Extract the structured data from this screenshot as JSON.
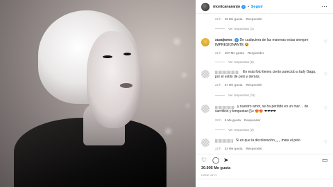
{
  "post": {
    "username": "monicanaranjo",
    "follow_label": "Seguir",
    "more_icon": "more-horizontal-icon",
    "verified_color": "#3897f0",
    "follow_color": "#0095f6"
  },
  "comments": [
    {
      "id": "c0",
      "meta": {
        "time": "22 h",
        "likes": "19 Me gusta",
        "reply": "Responder"
      },
      "replies": "Ver respuestas (1)"
    },
    {
      "id": "c1",
      "author": "xusojones",
      "text": "De cualquiera de las maneras estas siempre IMPRESIONANTE 😍",
      "meta": {
        "time": "21 h",
        "likes": "107 Me gusta",
        "reply": "Responder"
      },
      "replies": "Ver respuestas (6)"
    },
    {
      "id": "c2",
      "text": "En esta foto tienes cierto parecido a lady Gaga, por el estilo de pelo y demás.",
      "meta": {
        "time": "22 h",
        "likes": "37 Me gusta",
        "reply": "Responder"
      },
      "replies": "Ver respuestas (11)"
    },
    {
      "id": "c3",
      "text": "y nuestro amor, se ha perdido en un mar.... de sacrificio y tempestad 🌬 😍😍 ❤❤❤❤",
      "meta": {
        "time": "22 h",
        "likes": "6 Me gusta",
        "reply": "Responder"
      },
      "replies": "Ver respuestas (2)"
    },
    {
      "id": "c4",
      "text": "Si es que la decoloración,,,,,, mata el pelo",
      "meta": {
        "time": "22 h",
        "likes": "33 Me gusta",
        "reply": "Responder"
      }
    }
  ],
  "actions": {
    "like_icon": "heart-icon",
    "comment_icon": "comment-icon",
    "share_icon": "send-icon",
    "save_icon": "bookmark-icon"
  },
  "likes_count": "30.905 Me gusta",
  "post_time": "HACE 22 H"
}
